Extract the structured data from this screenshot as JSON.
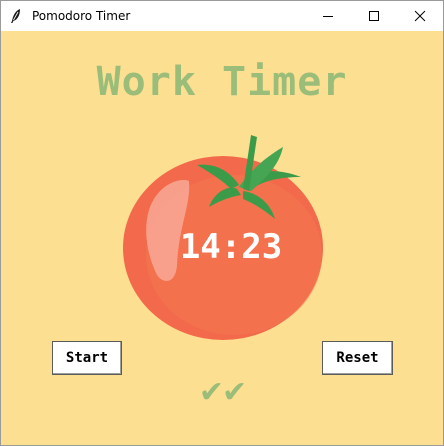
{
  "window": {
    "title": "Pomodoro Timer",
    "controls": {
      "minimize": "minimize-icon",
      "maximize": "maximize-icon",
      "close": "close-icon"
    }
  },
  "app": {
    "heading": "Work Timer",
    "timer": "14:23",
    "start_label": "Start",
    "reset_label": "Reset",
    "checkmarks": "✔✔"
  },
  "colors": {
    "background": "#fddf92",
    "heading_green": "#9bbd7a",
    "tomato_red": "#f26a4b",
    "leaf_green": "#3c9b48"
  }
}
